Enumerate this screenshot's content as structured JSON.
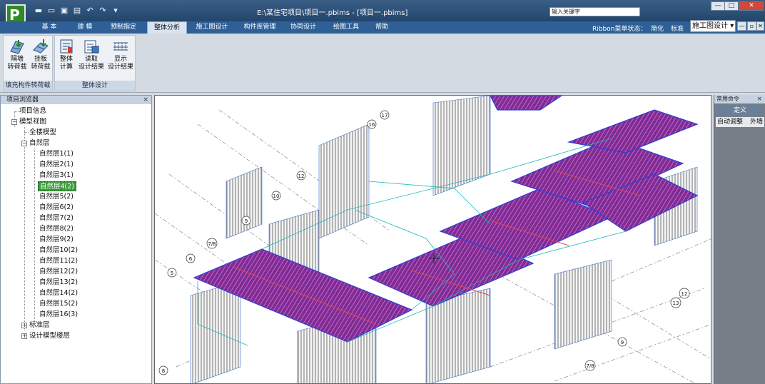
{
  "window": {
    "title": "E:\\某住宅项目\\项目一.pbims - [项目一.pbims]",
    "search_placeholder": "输入关键字",
    "controls": [
      "—",
      "□",
      "✕"
    ]
  },
  "quick_access": [
    "new-icon",
    "open-icon",
    "save-icon",
    "print-icon",
    "undo-icon",
    "redo-icon",
    "customize-icon"
  ],
  "tabs": [
    {
      "label": "基 本",
      "active": false
    },
    {
      "label": "建 模",
      "active": false
    },
    {
      "label": "预制指定",
      "active": false
    },
    {
      "label": "整体分析",
      "active": true
    },
    {
      "label": "施工图设计",
      "active": false
    },
    {
      "label": "构件库管理",
      "active": false
    },
    {
      "label": "协同设计",
      "active": false
    },
    {
      "label": "绘图工具",
      "active": false
    },
    {
      "label": "帮助",
      "active": false
    }
  ],
  "ribbon_state": {
    "label": "Ribbon菜单状态：",
    "options": [
      "简化",
      "标准"
    ],
    "mode_select": "施工图设计"
  },
  "ribbon_groups": [
    {
      "label": "填充构件转荷载",
      "buttons": [
        {
          "line1": "隔墙",
          "line2": "转荷载",
          "icon": "wall-load-icon"
        },
        {
          "line1": "挂板",
          "line2": "转荷载",
          "icon": "panel-load-icon"
        }
      ]
    },
    {
      "label": "整体设计",
      "buttons": [
        {
          "line1": "整体",
          "line2": "计算",
          "icon": "compute-icon"
        },
        {
          "line1": "读取",
          "line2": "设计结果",
          "icon": "read-result-icon"
        },
        {
          "line1": "显示",
          "line2": "设计结果",
          "icon": "show-result-icon"
        }
      ]
    }
  ],
  "left_panel": {
    "title": "项目浏览器",
    "close": "×",
    "tree": {
      "project_info": "项目信息",
      "model_view": "模型视图",
      "full_model": "全楼模型",
      "natural_floors": "自然层",
      "floors": [
        "自然层1(1)",
        "自然层2(1)",
        "自然层3(1)",
        "自然层4(2)",
        "自然层5(2)",
        "自然层6(2)",
        "自然层7(2)",
        "自然层8(2)",
        "自然层9(2)",
        "自然层10(2)",
        "自然层11(2)",
        "自然层12(2)",
        "自然层13(2)",
        "自然层14(2)",
        "自然层15(2)",
        "自然层16(3)"
      ],
      "selected_floor": "自然层4(2)",
      "standard_floors": "标准层",
      "design_model_floors": "设计模型楼层"
    }
  },
  "viewport": {
    "axis_labels": [
      "17",
      "16",
      "12",
      "10",
      "9",
      "7/8",
      "6",
      "5",
      "12",
      "13",
      "9",
      "7/8",
      "8"
    ]
  },
  "right_panel": {
    "title": "常用命令",
    "close": "×",
    "define": "定义",
    "commands": [
      "自动调整",
      "外墙"
    ]
  },
  "colors": {
    "title_bar": "#2b4f78",
    "tab_bar": "#2e5f97",
    "selected_node": "#3d9a3d",
    "slab_fill": "#6a2c7e",
    "rebar_purple": "#c040c8",
    "rebar_blue": "#2a3fd8"
  }
}
